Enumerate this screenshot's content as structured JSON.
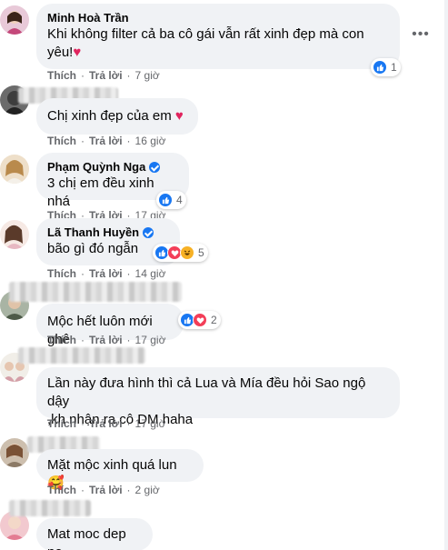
{
  "colors": {
    "link": "#1877f2",
    "bubble": "#f0f2f5",
    "meta": "#65676b"
  },
  "comments": [
    {
      "author": "Minh Hoà Trần",
      "text_line1": "Khi không filter cả ba cô gái vẫn rất xinh đẹp mà con",
      "text_line2": "yêu!",
      "emoji": "❤️",
      "like_label": "Thích",
      "reply_label": "Trả lời",
      "time": "7 giờ",
      "reactions": {
        "count": "1",
        "types": [
          "like"
        ]
      }
    },
    {
      "author": "",
      "text": "Chị xinh đẹp của em",
      "emoji": "❤️",
      "like_label": "Thích",
      "reply_label": "Trả lời",
      "time": "16 giờ"
    },
    {
      "author": "Phạm Quỳnh Nga",
      "verified": true,
      "text": "3 chị em đều xinh nhá",
      "like_label": "Thích",
      "reply_label": "Trả lời",
      "time": "17 giờ",
      "reactions": {
        "count": "4",
        "types": [
          "like"
        ]
      }
    },
    {
      "author": "Lã Thanh Huyền",
      "verified": true,
      "text": "bão gì đó ngẫn",
      "like_label": "Thích",
      "reply_label": "Trả lời",
      "time": "14 giờ",
      "reactions": {
        "count": "5",
        "types": [
          "like",
          "love",
          "haha"
        ]
      }
    },
    {
      "author": "",
      "text": "Mộc hết luôn mới ghê",
      "like_label": "Thích",
      "reply_label": "Trả lời",
      "time": "17 giờ",
      "reactions": {
        "count": "2",
        "types": [
          "like",
          "love"
        ]
      }
    },
    {
      "author": "",
      "text_line1": "Lần này đưa hình thì cả Lua và Mía đều hỏi Sao ngộ dậy",
      "text_line2": ",kh nhận ra cô DM haha",
      "like_label": "Thích",
      "reply_label": "Trả lời",
      "time": "17 giờ"
    },
    {
      "author": "",
      "text": "Mặt mộc xinh quá lun",
      "emoji": "🥰",
      "like_label": "Thích",
      "reply_label": "Trả lời",
      "time": "2 giờ"
    },
    {
      "author": "",
      "text": "Mat moc dep ne"
    }
  ],
  "more_icon": "more-horizontal-icon"
}
